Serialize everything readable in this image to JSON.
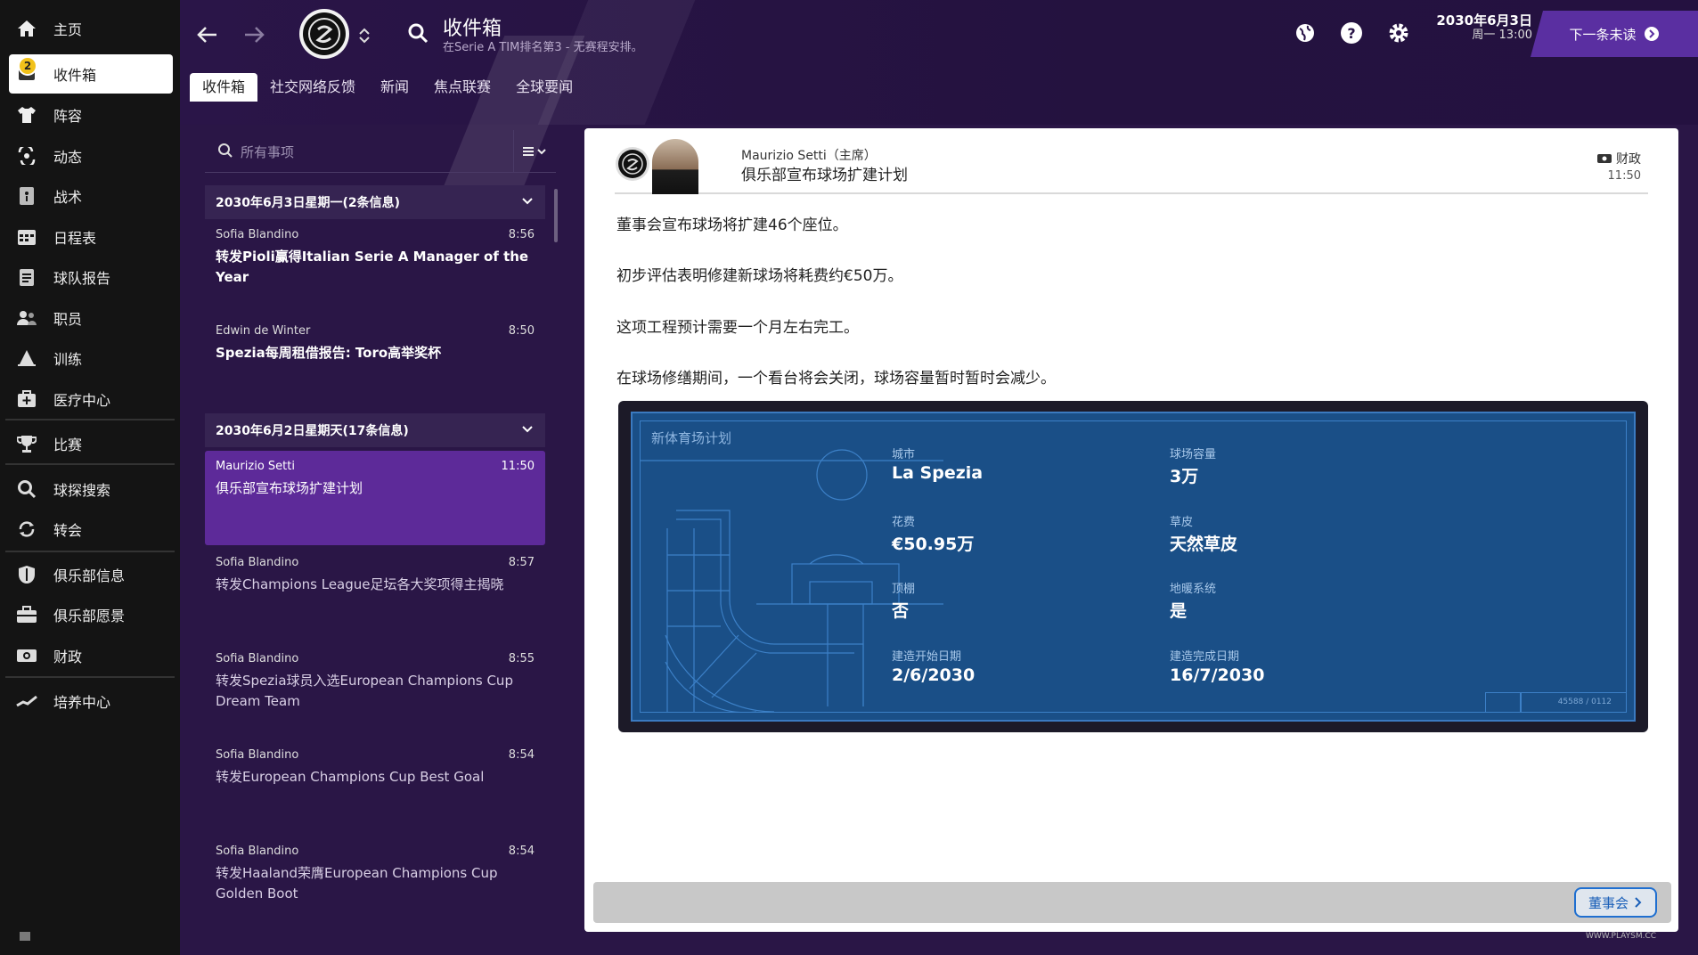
{
  "sidebar": {
    "badge_count": "2",
    "items": [
      {
        "label": "主页",
        "icon": "home-icon"
      },
      {
        "label": "收件箱",
        "icon": "inbox-icon"
      },
      {
        "label": "阵容",
        "icon": "shirt-icon"
      },
      {
        "label": "动态",
        "icon": "dynamics-icon"
      },
      {
        "label": "战术",
        "icon": "tactics-icon"
      },
      {
        "label": "日程表",
        "icon": "calendar-icon"
      },
      {
        "label": "球队报告",
        "icon": "report-icon"
      },
      {
        "label": "职员",
        "icon": "staff-icon"
      },
      {
        "label": "训练",
        "icon": "training-icon"
      },
      {
        "label": "医疗中心",
        "icon": "medical-icon"
      },
      {
        "label": "比赛",
        "icon": "trophy-icon"
      },
      {
        "label": "球探搜索",
        "icon": "scouting-icon"
      },
      {
        "label": "转会",
        "icon": "transfer-icon"
      },
      {
        "label": "俱乐部信息",
        "icon": "shield-icon"
      },
      {
        "label": "俱乐部愿景",
        "icon": "vision-icon"
      },
      {
        "label": "财政",
        "icon": "finance-icon"
      },
      {
        "label": "培养中心",
        "icon": "development-icon"
      }
    ]
  },
  "header": {
    "title": "收件箱",
    "subtitle": "在Serie A TIM排名第3 - 无赛程安排。",
    "tabs": [
      "收件箱",
      "社交网络反馈",
      "新闻",
      "焦点联赛",
      "全球要闻"
    ],
    "date": "2030年6月3日",
    "day_time": "周一 13:00",
    "next_button": "下一条未读",
    "colors": {
      "accent": "#5a2fa1",
      "background": "#2a1646"
    }
  },
  "list": {
    "search_placeholder": "所有事项",
    "groups": [
      {
        "header": "2030年6月3日星期一(2条信息)",
        "messages": [
          {
            "sender": "Sofia Blandino",
            "time": "8:56",
            "subject": "转发Pioli赢得Italian Serie A Manager of the Year"
          },
          {
            "sender": "Edwin de Winter",
            "time": "8:50",
            "subject": "Spezia每周租借报告: Toro高举奖杯"
          }
        ]
      },
      {
        "header": "2030年6月2日星期天(17条信息)",
        "messages": [
          {
            "sender": "Maurizio Setti",
            "time": "11:50",
            "subject": "俱乐部宣布球场扩建计划"
          },
          {
            "sender": "Sofia Blandino",
            "time": "8:57",
            "subject": "转发Champions League足坛各大奖项得主揭晓"
          },
          {
            "sender": "Sofia Blandino",
            "time": "8:55",
            "subject": "转发Spezia球员入选European Champions Cup Dream Team"
          },
          {
            "sender": "Sofia Blandino",
            "time": "8:54",
            "subject": "转发European Champions Cup Best Goal"
          },
          {
            "sender": "Sofia Blandino",
            "time": "8:54",
            "subject": "转发Haaland荣膺European Champions Cup Golden Boot"
          }
        ]
      }
    ]
  },
  "detail": {
    "from": "Maurizio Setti（主席）",
    "subject": "俱乐部宣布球场扩建计划",
    "category": "财政",
    "time": "11:50",
    "paragraphs": [
      "董事会宣布球场将扩建46个座位。",
      "初步评估表明修建新球场将耗费约€50万。",
      "这项工程预计需要一个月左右完工。",
      "在球场修缮期间，一个看台将会关闭，球场容量暂时暂时会减少。"
    ],
    "blueprint": {
      "title": "新体育场计划",
      "fields": [
        {
          "label": "城市",
          "value": "La Spezia"
        },
        {
          "label": "球场容量",
          "value": "3万"
        },
        {
          "label": "花费",
          "value": "€50.95万"
        },
        {
          "label": "草皮",
          "value": "天然草皮"
        },
        {
          "label": "顶棚",
          "value": "否"
        },
        {
          "label": "地暖系统",
          "value": "是"
        },
        {
          "label": "建造开始日期",
          "value": "2/6/2030"
        },
        {
          "label": "建造完成日期",
          "value": "16/7/2030"
        }
      ],
      "code": "45588 / 0112"
    },
    "board_button": "董事会"
  },
  "watermark": "WWW.PLAYSM.CC"
}
